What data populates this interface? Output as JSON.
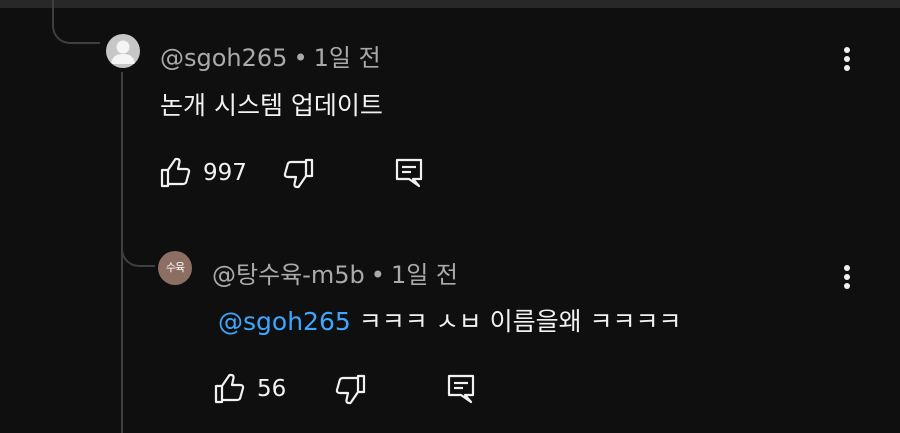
{
  "comments": [
    {
      "author": "@sgoh265",
      "separator": "•",
      "time": "1일 전",
      "text": "논개 시스템 업데이트",
      "mention": "",
      "likes": "997",
      "avatar_icon": "person-silhouette-icon"
    },
    {
      "author": "@탕수육-m5b",
      "separator": "•",
      "time": "1일 전",
      "avatar_text": "수육",
      "mention": "@sgoh265",
      "text": "ㅋㅋㅋ ㅅㅂ 이름을왜 ㅋㅋㅋㅋ",
      "likes": "56"
    }
  ],
  "colors": {
    "background": "#0f0f0f",
    "text_primary": "#f1f1f1",
    "text_secondary": "#aaaaaa",
    "mention": "#3ea6ff",
    "avatar_reply": "#8d6e63",
    "avatar_default": "#c7c7c7"
  }
}
